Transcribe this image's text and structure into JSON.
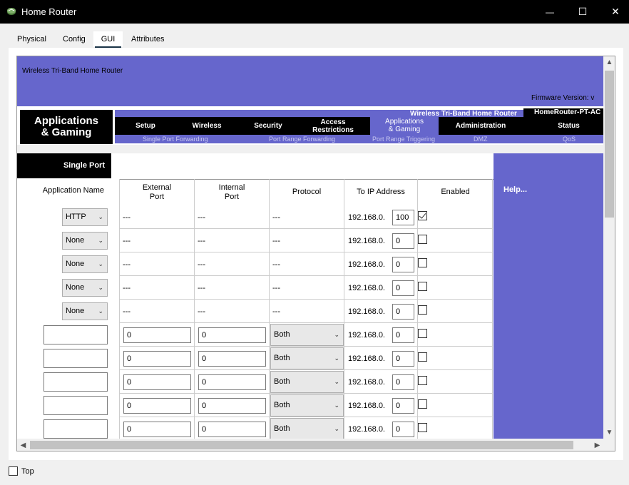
{
  "window": {
    "title": "Home Router",
    "minimize_glyph": "—",
    "maximize_glyph": "☐",
    "close_glyph": "✕"
  },
  "tabs": [
    {
      "label": "Physical",
      "active": false
    },
    {
      "label": "Config",
      "active": false
    },
    {
      "label": "GUI",
      "active": true
    },
    {
      "label": "Attributes",
      "active": false
    }
  ],
  "banner": {
    "product_name": "Wireless Tri-Band Home Router",
    "firmware_label": "Firmware Version: v"
  },
  "nav": {
    "section_title_line1": "Applications",
    "section_title_line2": "& Gaming",
    "product_title": "Wireless Tri-Band Home Router",
    "model": "HomeRouter-PT-AC",
    "items": [
      {
        "label": "Setup",
        "label2": "",
        "active": false
      },
      {
        "label": "Wireless",
        "label2": "",
        "active": false
      },
      {
        "label": "Security",
        "label2": "",
        "active": false
      },
      {
        "label": "Access",
        "label2": "Restrictions",
        "active": false
      },
      {
        "label": "Applications",
        "label2": "& Gaming",
        "active": true
      },
      {
        "label": "Administration",
        "label2": "",
        "active": false
      },
      {
        "label": "Status",
        "label2": "",
        "active": false
      }
    ],
    "subitems": [
      "Single Port Forwarding",
      "Port Range Forwarding",
      "Port Range Triggering",
      "DMZ",
      "QoS"
    ]
  },
  "single_port": {
    "heading": "Single Port",
    "app_name_label": "Application Name",
    "headers": {
      "external_port_line1": "External",
      "external_port_line2": "Port",
      "internal_port_line1": "Internal",
      "internal_port_line2": "Port",
      "protocol": "Protocol",
      "to_ip": "To IP Address",
      "enabled": "Enabled"
    },
    "ip_prefix": "192.168.0.",
    "dash": "---",
    "preset_rows": [
      {
        "app": "HTTP",
        "ip_last": "100",
        "enabled": true
      },
      {
        "app": "None",
        "ip_last": "0",
        "enabled": false
      },
      {
        "app": "None",
        "ip_last": "0",
        "enabled": false
      },
      {
        "app": "None",
        "ip_last": "0",
        "enabled": false
      },
      {
        "app": "None",
        "ip_last": "0",
        "enabled": false
      }
    ],
    "custom_rows": [
      {
        "app": "",
        "external": "0",
        "internal": "0",
        "protocol": "Both",
        "ip_last": "0",
        "enabled": false
      },
      {
        "app": "",
        "external": "0",
        "internal": "0",
        "protocol": "Both",
        "ip_last": "0",
        "enabled": false
      },
      {
        "app": "",
        "external": "0",
        "internal": "0",
        "protocol": "Both",
        "ip_last": "0",
        "enabled": false
      },
      {
        "app": "",
        "external": "0",
        "internal": "0",
        "protocol": "Both",
        "ip_last": "0",
        "enabled": false
      },
      {
        "app": "",
        "external": "0",
        "internal": "0",
        "protocol": "Both",
        "ip_last": "0",
        "enabled": false
      }
    ]
  },
  "help": {
    "label": "Help..."
  },
  "footer": {
    "top_label": "Top",
    "top_checked": false
  },
  "colors": {
    "accent": "#6666cc",
    "black": "#000000"
  }
}
